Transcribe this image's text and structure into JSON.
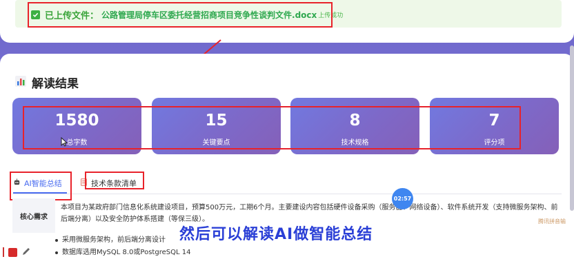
{
  "upload": {
    "label": "已上传文件：",
    "filename": "公路管理局停车区委托经营招商项目竞争性谈判文件.docx",
    "status": "上传成功"
  },
  "results": {
    "title": "解读结果",
    "stats": [
      {
        "value": "1580",
        "label": "总字数"
      },
      {
        "value": "15",
        "label": "关键要点"
      },
      {
        "value": "8",
        "label": "技术规格"
      },
      {
        "value": "7",
        "label": "评分项"
      }
    ]
  },
  "tabs": [
    {
      "label": "AI智能总结",
      "icon": "robot-icon",
      "active": true
    },
    {
      "label": "技术条款清单",
      "icon": "document-icon",
      "active": false
    }
  ],
  "summary": {
    "label": "核心需求",
    "text": "本项目为某政府部门信息化系统建设项目，预算500万元，工期6个月。主要建设内容包括硬件设备采购（服务器、网络设备）、软件系统开发（支持微服务架构、前后端分离）以及安全防护体系搭建（等保三级）。",
    "bullets": [
      "采用微服务架构，前后端分离设计",
      "数据库选用MySQL 8.0或PostgreSQL 14"
    ]
  },
  "overlay": {
    "timer": "02:57",
    "subtitle": "然后可以解读AI做智能总结",
    "watermark": "腾讯拼音输"
  },
  "colors": {
    "accent": "#4a6cf0",
    "annotation_red": "#e8222a",
    "success_green": "#3aa43a",
    "card_gradient_start": "#7179e0",
    "card_gradient_end": "#8560b8"
  }
}
